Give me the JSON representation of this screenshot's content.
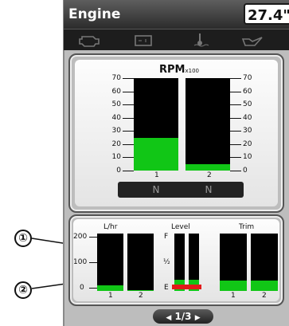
{
  "header": {
    "title": "Engine",
    "value": "27.4\""
  },
  "icons": [
    "engine-icon",
    "battery-icon",
    "temperature-icon",
    "oil-icon"
  ],
  "rpm": {
    "title": "RPM",
    "unit": "x100",
    "ticks": [
      "70",
      "60",
      "50",
      "40",
      "30",
      "20",
      "10",
      "0"
    ],
    "engines": [
      {
        "label": "1",
        "value": 25,
        "gear": "N"
      },
      {
        "label": "2",
        "value": 5,
        "gear": "N"
      }
    ]
  },
  "fuel": {
    "title": "L/hr",
    "ticks": [
      "200",
      "100",
      "0"
    ],
    "engines": [
      {
        "label": "1",
        "value": 20
      },
      {
        "label": "2",
        "value": 3
      }
    ]
  },
  "level": {
    "title": "Level",
    "ticks": [
      "F",
      "½",
      "E"
    ],
    "tanks": [
      {
        "value": 0.2
      },
      {
        "value": 0.2
      }
    ]
  },
  "trim": {
    "title": "Trim",
    "engines": [
      {
        "label": "1",
        "value": 0.18
      },
      {
        "label": "2",
        "value": 0.18
      }
    ]
  },
  "callouts": [
    "①",
    "②"
  ],
  "pager": {
    "text": "1/3",
    "prev": "◀",
    "next": "▶"
  },
  "colors": {
    "fill": "#11c616",
    "warning": "#e21b1b"
  }
}
